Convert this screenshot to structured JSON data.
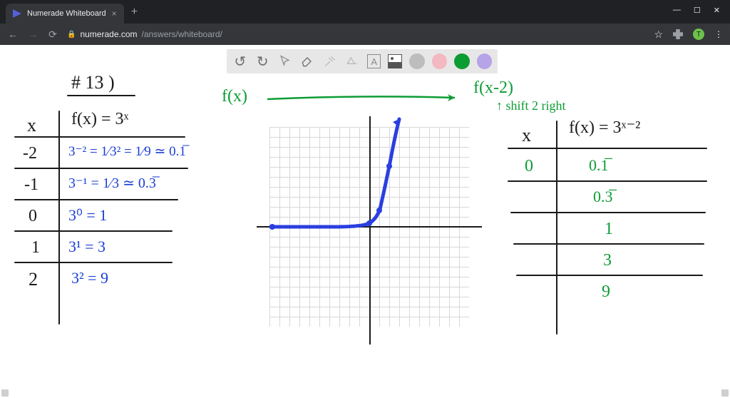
{
  "browser": {
    "tab_title": "Numerade Whiteboard",
    "url_host": "numerade.com",
    "url_path": "/answers/whiteboard/",
    "star": "☆",
    "avatar_initial": "T",
    "menu_dots": "⋮",
    "newtab": "+",
    "close": "×",
    "min": "—",
    "max": "☐",
    "winclose": "✕",
    "back": "←",
    "fwd": "→",
    "reload": "⟳",
    "lock": "🔒"
  },
  "toolbar": {
    "undo_glyph": "↺",
    "redo_glyph": "↻",
    "text_A": "A"
  },
  "board": {
    "title": "# 13 )",
    "fx_label": "f(x)",
    "fx2_label": "f(x-2)",
    "shift_note": "↑ shift 2 right",
    "left_header_x": "x",
    "left_header_fx": "f(x) = 3ˣ",
    "left_rows": {
      "r0x": "-2",
      "r0f": "3⁻² = 1⁄3² = 1⁄9 ≃ 0.1̅",
      "r1x": "-1",
      "r1f": "3⁻¹ = 1⁄3 ≃ 0.3̅",
      "r2x": "0",
      "r2f": "3⁰ = 1",
      "r3x": "1",
      "r3f": "3¹ = 3",
      "r4x": "2",
      "r4f": "3² = 9"
    },
    "right_header_x": "x",
    "right_header_fx": "f(x) = 3ˣ⁻²",
    "right_rows": {
      "r0x": "0",
      "r0f": "0.1̅",
      "r1x": "",
      "r1f": "0.3̅",
      "r2x": "",
      "r2f": "1",
      "r3x": "",
      "r3f": "3",
      "r4x": "",
      "r4f": "9"
    }
  },
  "chart_data": {
    "type": "line",
    "title": "f(x) = 3^x",
    "xlabel": "",
    "ylabel": "",
    "xlim": [
      -10,
      10
    ],
    "ylim": [
      -10,
      10
    ],
    "series": [
      {
        "name": "3^x",
        "x": [
          -10,
          -5,
          -2,
          -1,
          0,
          1,
          1.5,
          2,
          2.1
        ],
        "y": [
          0,
          0,
          0.11,
          0.33,
          1,
          3,
          5.2,
          9,
          10
        ]
      }
    ]
  }
}
